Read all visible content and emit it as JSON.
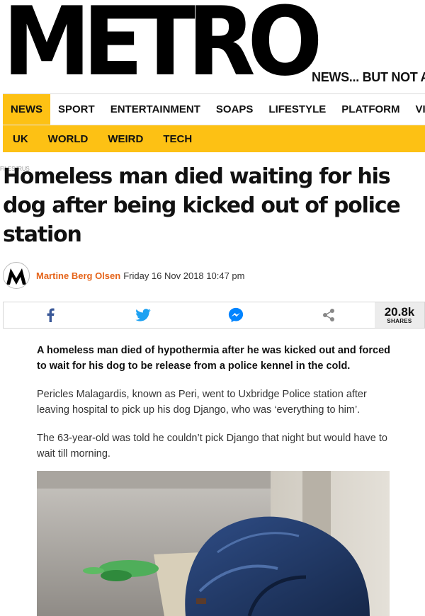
{
  "site": {
    "logo": "METRO",
    "tagline": "NEWS... BUT NOT AS"
  },
  "nav_primary": [
    {
      "label": "NEWS",
      "active": true
    },
    {
      "label": "SPORT",
      "active": false
    },
    {
      "label": "ENTERTAINMENT",
      "active": false
    },
    {
      "label": "SOAPS",
      "active": false
    },
    {
      "label": "LIFESTYLE",
      "active": false
    },
    {
      "label": "PLATFORM",
      "active": false
    },
    {
      "label": "VIDEO",
      "active": false
    }
  ],
  "nav_secondary": [
    "UK",
    "WORLD",
    "WEIRD",
    "TECH"
  ],
  "article": {
    "breadcrumb": "FILES/IRUS",
    "headline": "Homeless man died waiting for his dog after being kicked out of police station",
    "author": "Martine Berg Olsen",
    "date": "Friday 16 Nov 2018 10:47 pm",
    "share": {
      "count": "20.8k",
      "label": "SHARES",
      "facebook_icon": "facebook-icon",
      "twitter_icon": "twitter-icon",
      "messenger_icon": "messenger-icon",
      "share_icon": "share-icon"
    },
    "lead": "A homeless man died of hypothermia after he was kicked out and forced to wait for his dog to be release from a police kennel in the cold.",
    "paragraphs": [
      "Pericles Malagardis, known as Peri, went to Uxbridge Police station after leaving hospital to pick up his dog Django, who was ‘everything to him’.",
      "The 63-year-old was told he couldn’t pick Django that night but would have to wait till morning."
    ]
  },
  "colors": {
    "brand_yellow": "#fdc114",
    "author_orange": "#e5641a",
    "facebook_blue": "#3b5998",
    "twitter_blue": "#1da1f2",
    "messenger_blue": "#0084ff"
  }
}
